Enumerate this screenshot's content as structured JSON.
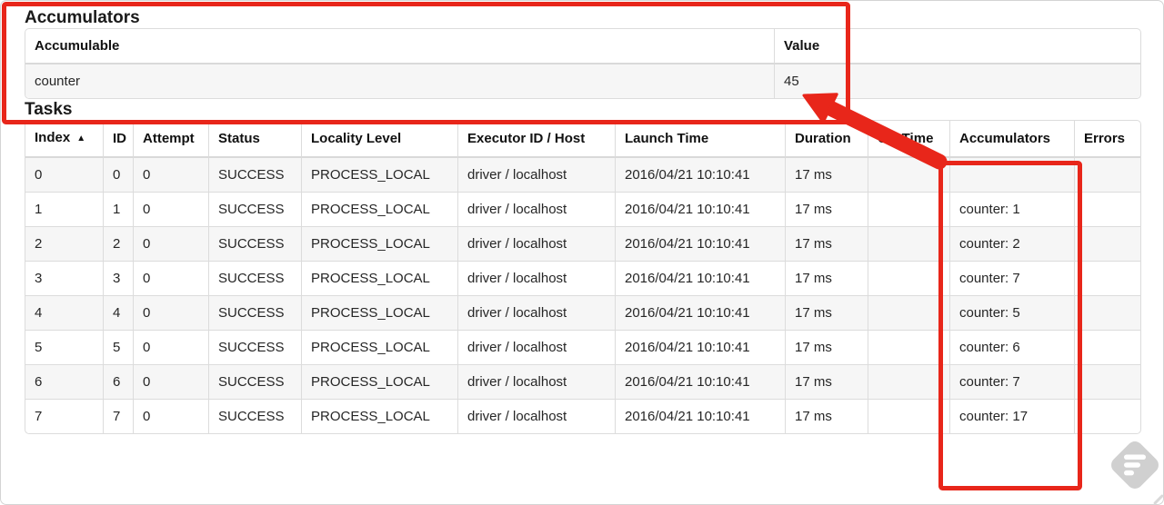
{
  "accumulators": {
    "title": "Accumulators",
    "columns": {
      "accumulable": "Accumulable",
      "value": "Value"
    },
    "rows": [
      {
        "accumulable": "counter",
        "value": "45"
      }
    ]
  },
  "tasks": {
    "title": "Tasks",
    "sort_icon": "▲",
    "columns": {
      "index": "Index",
      "id": "ID",
      "attempt": "Attempt",
      "status": "Status",
      "locality": "Locality Level",
      "executor": "Executor ID / Host",
      "launch": "Launch Time",
      "duration": "Duration",
      "gc": "GC Time",
      "accumulators": "Accumulators",
      "errors": "Errors"
    },
    "rows": [
      {
        "index": "0",
        "id": "0",
        "attempt": "0",
        "status": "SUCCESS",
        "locality": "PROCESS_LOCAL",
        "executor": "driver / localhost",
        "launch": "2016/04/21 10:10:41",
        "duration": "17 ms",
        "gc": "",
        "accumulators": "",
        "errors": ""
      },
      {
        "index": "1",
        "id": "1",
        "attempt": "0",
        "status": "SUCCESS",
        "locality": "PROCESS_LOCAL",
        "executor": "driver / localhost",
        "launch": "2016/04/21 10:10:41",
        "duration": "17 ms",
        "gc": "",
        "accumulators": "counter: 1",
        "errors": ""
      },
      {
        "index": "2",
        "id": "2",
        "attempt": "0",
        "status": "SUCCESS",
        "locality": "PROCESS_LOCAL",
        "executor": "driver / localhost",
        "launch": "2016/04/21 10:10:41",
        "duration": "17 ms",
        "gc": "",
        "accumulators": "counter: 2",
        "errors": ""
      },
      {
        "index": "3",
        "id": "3",
        "attempt": "0",
        "status": "SUCCESS",
        "locality": "PROCESS_LOCAL",
        "executor": "driver / localhost",
        "launch": "2016/04/21 10:10:41",
        "duration": "17 ms",
        "gc": "",
        "accumulators": "counter: 7",
        "errors": ""
      },
      {
        "index": "4",
        "id": "4",
        "attempt": "0",
        "status": "SUCCESS",
        "locality": "PROCESS_LOCAL",
        "executor": "driver / localhost",
        "launch": "2016/04/21 10:10:41",
        "duration": "17 ms",
        "gc": "",
        "accumulators": "counter: 5",
        "errors": ""
      },
      {
        "index": "5",
        "id": "5",
        "attempt": "0",
        "status": "SUCCESS",
        "locality": "PROCESS_LOCAL",
        "executor": "driver / localhost",
        "launch": "2016/04/21 10:10:41",
        "duration": "17 ms",
        "gc": "",
        "accumulators": "counter: 6",
        "errors": ""
      },
      {
        "index": "6",
        "id": "6",
        "attempt": "0",
        "status": "SUCCESS",
        "locality": "PROCESS_LOCAL",
        "executor": "driver / localhost",
        "launch": "2016/04/21 10:10:41",
        "duration": "17 ms",
        "gc": "",
        "accumulators": "counter: 7",
        "errors": ""
      },
      {
        "index": "7",
        "id": "7",
        "attempt": "0",
        "status": "SUCCESS",
        "locality": "PROCESS_LOCAL",
        "executor": "driver / localhost",
        "launch": "2016/04/21 10:10:41",
        "duration": "17 ms",
        "gc": "",
        "accumulators": "counter: 17",
        "errors": ""
      }
    ]
  },
  "colors": {
    "annotation_red": "#e8261a",
    "watermark_gray": "#cdcdcd"
  }
}
